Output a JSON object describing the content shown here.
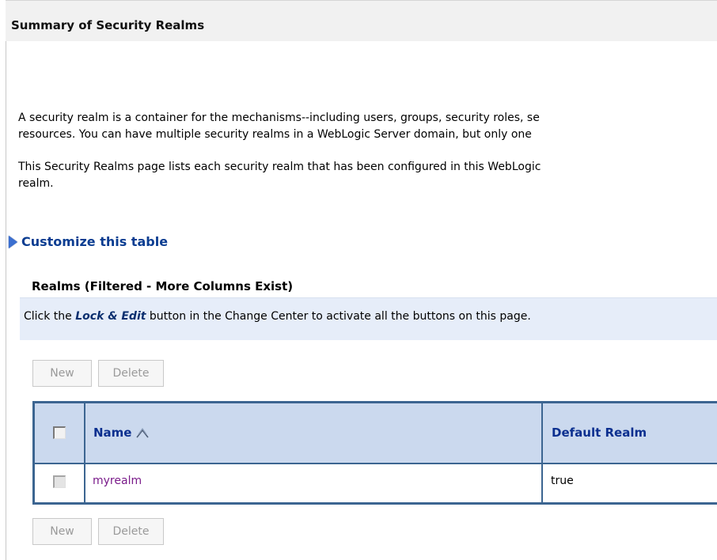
{
  "title": "Summary of Security Realms",
  "description": {
    "para1_line1": "A security realm is a container for the mechanisms--including users, groups, security roles, se",
    "para1_line2": "resources. You can have multiple security realms in a WebLogic Server domain, but only one",
    "para2_line1": "This Security Realms page lists each security realm that has been configured in this WebLogic",
    "para2_line2": "realm."
  },
  "customize_link": "Customize this table",
  "table_title": "Realms (Filtered - More Columns Exist)",
  "info": {
    "prefix": "Click the ",
    "emphasis": "Lock & Edit",
    "suffix": " button in the Change Center to activate all the buttons on this page."
  },
  "buttons": {
    "new_label": "New",
    "delete_label": "Delete"
  },
  "table": {
    "columns": [
      "Name",
      "Default Realm"
    ],
    "rows": [
      {
        "name": "myrealm",
        "default_realm": "true"
      }
    ]
  },
  "icons": {
    "expand": "triangle-right-icon",
    "sort": "sort-ascending-icon",
    "checkbox": "checkbox-icon"
  },
  "colors": {
    "link": "#0b3d91",
    "visited_link": "#7a1b8a",
    "table_border": "#3c6591",
    "header_bg": "#cbd9ee",
    "info_bg": "#e6edf9"
  }
}
